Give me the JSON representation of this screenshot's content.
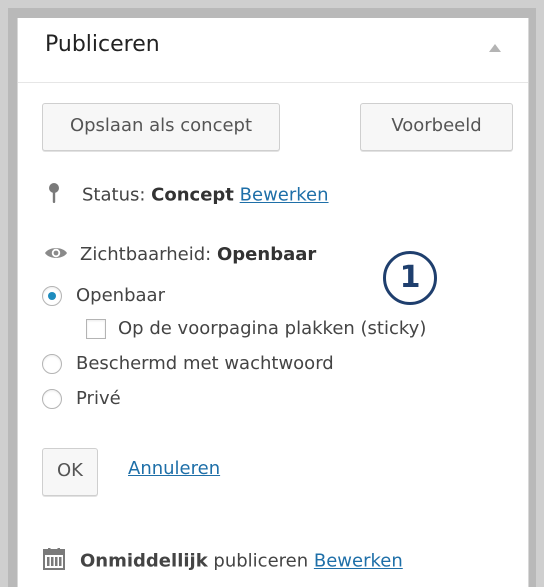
{
  "panel": {
    "title": "Publiceren",
    "buttons": {
      "save_draft": "Opslaan als concept",
      "preview": "Voorbeeld"
    },
    "status": {
      "label": "Status:",
      "value": "Concept",
      "edit_link": "Bewerken",
      "icon": "pin-icon"
    },
    "visibility": {
      "label": "Zichtbaarheid:",
      "value": "Openbaar",
      "icon": "eye-icon",
      "options": [
        {
          "label": "Openbaar",
          "checked": true
        },
        {
          "label": "Beschermd met wachtwoord",
          "checked": false
        },
        {
          "label": "Privé",
          "checked": false
        }
      ],
      "sticky_label": "Op de voorpagina plakken (sticky)",
      "sticky_checked": false
    },
    "annotation_badge": "1",
    "actions": {
      "ok": "OK",
      "cancel": "Annuleren"
    },
    "publish": {
      "value": "Onmiddellijk",
      "label": "publiceren",
      "edit_link": "Bewerken",
      "icon": "calendar-icon"
    }
  },
  "colors": {
    "link": "#1e6fa8",
    "radio_selected": "#1e8cbe",
    "badge": "#1f3f6e"
  }
}
